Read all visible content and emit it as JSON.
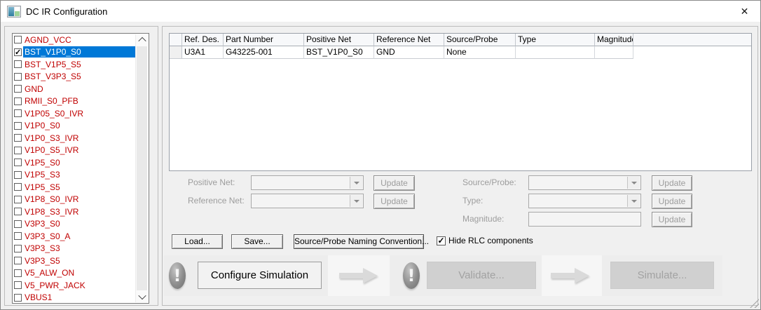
{
  "window": {
    "title": "DC IR Configuration"
  },
  "icons": {
    "close": "✕",
    "check": "✓",
    "exclamation": "!",
    "combo_arrow": "dropdown-triangle",
    "flow_arrow": "right-arrow"
  },
  "colors": {
    "net_text": "#c00000",
    "selection": "#0078d7",
    "disabled_text": "#9d9d9d"
  },
  "net_list": {
    "items": [
      {
        "label": "AGND_VCC",
        "checked": false,
        "selected": false
      },
      {
        "label": "BST_V1P0_S0",
        "checked": true,
        "selected": true
      },
      {
        "label": "BST_V1P5_S5",
        "checked": false,
        "selected": false
      },
      {
        "label": "BST_V3P3_S5",
        "checked": false,
        "selected": false
      },
      {
        "label": "GND",
        "checked": false,
        "selected": false
      },
      {
        "label": "RMII_S0_PFB",
        "checked": false,
        "selected": false
      },
      {
        "label": "V1P05_S0_IVR",
        "checked": false,
        "selected": false
      },
      {
        "label": "V1P0_S0",
        "checked": false,
        "selected": false
      },
      {
        "label": "V1P0_S3_IVR",
        "checked": false,
        "selected": false
      },
      {
        "label": "V1P0_S5_IVR",
        "checked": false,
        "selected": false
      },
      {
        "label": "V1P5_S0",
        "checked": false,
        "selected": false
      },
      {
        "label": "V1P5_S3",
        "checked": false,
        "selected": false
      },
      {
        "label": "V1P5_S5",
        "checked": false,
        "selected": false
      },
      {
        "label": "V1P8_S0_IVR",
        "checked": false,
        "selected": false
      },
      {
        "label": "V1P8_S3_IVR",
        "checked": false,
        "selected": false
      },
      {
        "label": "V3P3_S0",
        "checked": false,
        "selected": false
      },
      {
        "label": "V3P3_S0_A",
        "checked": false,
        "selected": false
      },
      {
        "label": "V3P3_S3",
        "checked": false,
        "selected": false
      },
      {
        "label": "V3P3_S5",
        "checked": false,
        "selected": false
      },
      {
        "label": "V5_ALW_ON",
        "checked": false,
        "selected": false
      },
      {
        "label": "V5_PWR_JACK",
        "checked": false,
        "selected": false
      },
      {
        "label": "VBUS1",
        "checked": false,
        "selected": false
      }
    ]
  },
  "table": {
    "columns": [
      "Ref. Des.",
      "Part Number",
      "Positive Net",
      "Reference Net",
      "Source/Probe",
      "Type",
      "Magnitude"
    ],
    "rows": [
      [
        "U3A1",
        "G43225-001",
        "BST_V1P0_S0",
        "GND",
        "None",
        "",
        ""
      ]
    ]
  },
  "editors": {
    "positive_net": {
      "label": "Positive Net:",
      "value": ""
    },
    "reference_net": {
      "label": "Reference Net:",
      "value": ""
    },
    "source_probe": {
      "label": "Source/Probe:",
      "value": ""
    },
    "type": {
      "label": "Type:",
      "value": ""
    },
    "magnitude": {
      "label": "Magnitude:",
      "value": ""
    },
    "update_label": "Update"
  },
  "toolbar": {
    "load": "Load...",
    "save": "Save...",
    "naming": "Source/Probe Naming Convention...",
    "hide_rlc_label": "Hide RLC components",
    "hide_rlc_checked": true
  },
  "workflow": {
    "configure": "Configure Simulation",
    "validate": "Validate...",
    "simulate": "Simulate..."
  }
}
